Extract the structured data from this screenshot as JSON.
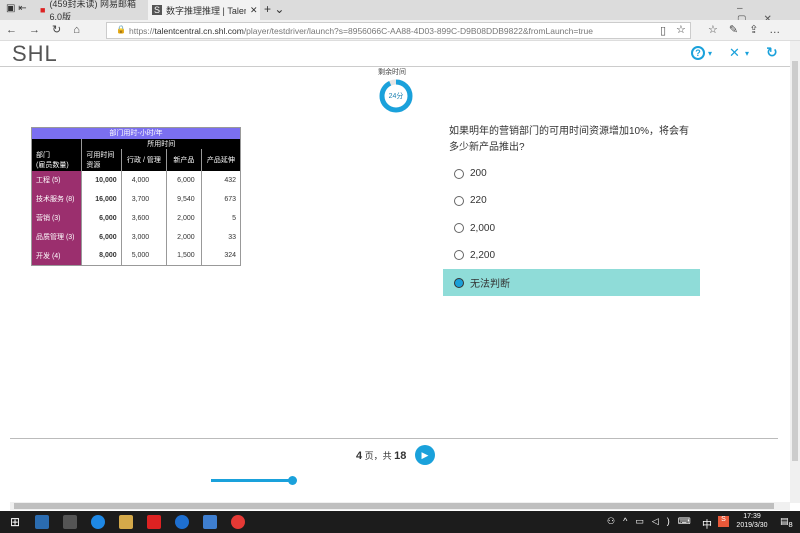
{
  "browser": {
    "tabs": [
      {
        "title": "(459封未读) 网易邮箱6.0版"
      },
      {
        "title": "数字推理推理 | TalentCe"
      }
    ],
    "url_prefix": "https://",
    "url_host": "talentcentral.cn.shl.com",
    "url_path": "/player/testdriver/launch?s=8956066C-AA88-4D03-899C-D9B08DDB9822&fromLaunch=true"
  },
  "header": {
    "logo": "SHL"
  },
  "timer": {
    "label": "剩余时间",
    "value": "24分",
    "fraction": 0.93
  },
  "table": {
    "title": "部门用时-小时/年",
    "subtitle": "所用时间",
    "headers": [
      "部门\n(雇员数量)",
      "可用时间\n资源",
      "行政 / 管理",
      "新产品",
      "产品延伸"
    ],
    "rows": [
      [
        "工程 (5)",
        "10,000",
        "4,000",
        "6,000",
        "432"
      ],
      [
        "技术服务 (8)",
        "16,000",
        "3,700",
        "9,540",
        "673"
      ],
      [
        "营销 (3)",
        "6,000",
        "3,600",
        "2,000",
        "5"
      ],
      [
        "品质管理 (3)",
        "6,000",
        "3,000",
        "2,000",
        "33"
      ],
      [
        "开发 (4)",
        "8,000",
        "5,000",
        "1,500",
        "324"
      ]
    ]
  },
  "question": {
    "text": "如果明年的营销部门的可用时间资源增加10%，将会有多少新产品推出?",
    "options": [
      "200",
      "220",
      "2,000",
      "2,200",
      "无法判断"
    ],
    "selected": 4
  },
  "pagination": {
    "current": "4",
    "sep": "页，共",
    "total": "18"
  },
  "progress": {
    "fraction": 1.0
  },
  "taskbar": {
    "time": "17:39",
    "date": "2019/3/30",
    "ime": "中",
    "notif": "8"
  }
}
